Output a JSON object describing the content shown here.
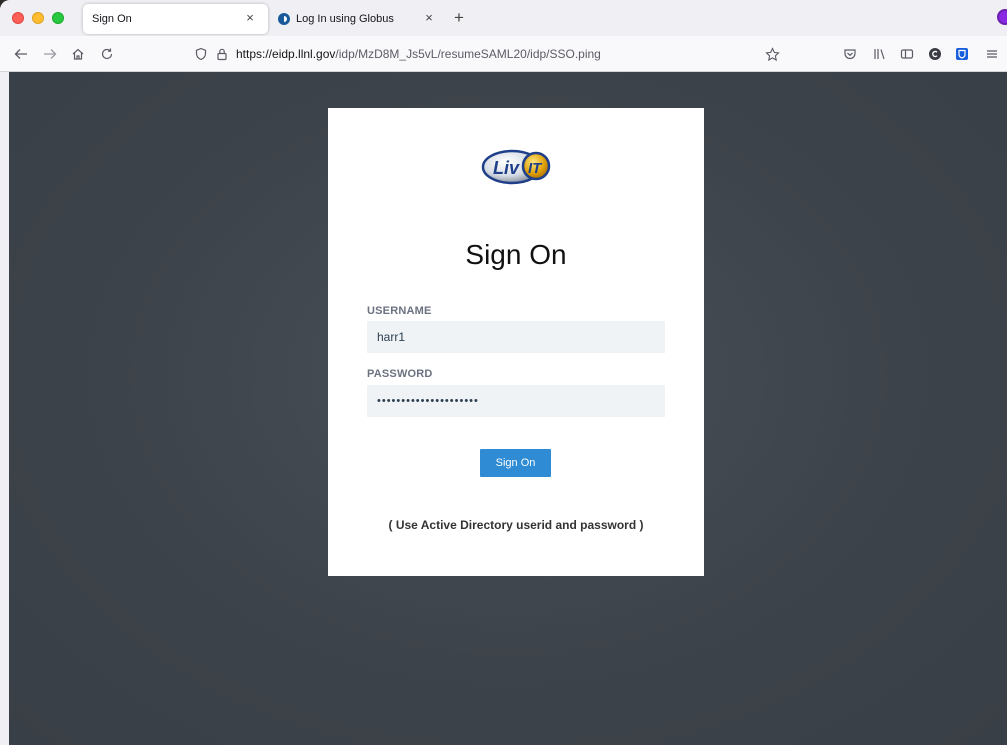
{
  "browser": {
    "tabs": [
      {
        "label": "Sign On",
        "active": true
      },
      {
        "label": "Log In using Globus",
        "active": false
      }
    ],
    "close_glyph": "×",
    "newtab_glyph": "+",
    "url_host": "https://eidp.llnl.gov",
    "url_path": "/idp/MzD8M_Js5vL/resumeSAML20/idp/SSO.ping",
    "toolbar_icons": [
      "back-icon",
      "forward-icon",
      "home-icon",
      "reload-icon",
      "shield-icon",
      "lock-icon",
      "bookmark-star-icon",
      "pocket-icon",
      "library-icon",
      "sidebar-icon",
      "extension-c-icon",
      "bitwarden-icon",
      "menu-icon"
    ]
  },
  "login": {
    "logo_text": "Liv",
    "logo_badge": "IT",
    "title": "Sign On",
    "username_label": "USERNAME",
    "username_value": "harr1",
    "password_label": "PASSWORD",
    "password_value": "•••••••••••••••••••••",
    "submit_label": "Sign On",
    "hint": "( Use Active Directory userid and password )"
  },
  "colors": {
    "button": "#2e8bd4",
    "background": "#3d434a",
    "field": "#eff3f6"
  }
}
